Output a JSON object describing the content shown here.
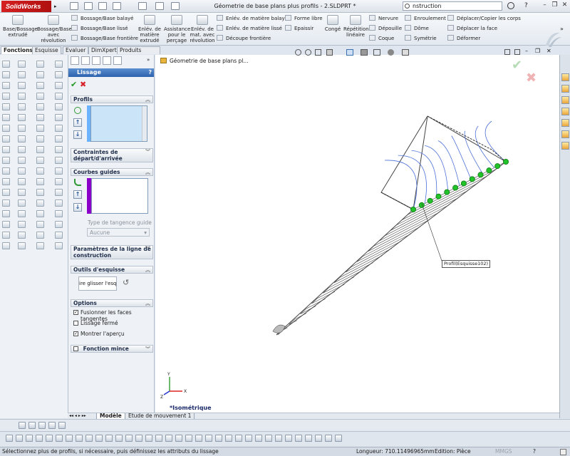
{
  "window": {
    "doc_title": "Géometrie de base plans plus profils - 2.SLDPRT *",
    "search_value": "nstruction",
    "min": "–",
    "restore": "❐",
    "close": "✕"
  },
  "ribbon": {
    "extrude": "Base/Bossage extrudé",
    "revolve": "Bossage/Base avec révolution",
    "sweep": "Bossage/Base balayé",
    "loft": "Bossage/Base lissé",
    "boundary": "Bossage/Base frontière",
    "cut_extrude": "Enlév. de matière extrudé",
    "hole": "Assistance pour le perçage",
    "cut_revolve": "Enlév. de mat. avec révolution",
    "cut_sweep": "Enlév. de matière balayé",
    "cut_loft": "Enlév. de matière lissé",
    "cut_boundary": "Découpe frontière",
    "freeform": "Forme libre",
    "thicken": "Epaissir",
    "fillet": "Congé",
    "pattern": "Répétition linéaire",
    "rib": "Nervure",
    "draft": "Dépouille",
    "shell": "Coque",
    "wrap": "Enroulement",
    "dome": "Dôme",
    "mirror": "Symétrie",
    "move_copy": "Déplacer/Copier les corps",
    "move_face": "Déplacer la face",
    "deform": "Déformer"
  },
  "tabs": [
    "Fonctions",
    "Esquisse",
    "Evaluer",
    "DimXpert",
    "Produits Office"
  ],
  "pm": {
    "title": "Lissage",
    "help": "?",
    "ok": "✔",
    "cancel": "✖",
    "profils_label": "Profils",
    "contraintes_label": "Contraintes de départ/d'arrivée",
    "courbes_label": "Courbes guides",
    "tangence_label": "Type de tangence guide",
    "tangence_value": "Aucune",
    "params_label": "Paramètres de la ligne de construction",
    "outils_label": "Outils d'esquisse",
    "drag_sketch": "ire glisser l'esquis",
    "options_label": "Options",
    "opt_merge": "Fusionner les faces tangentes",
    "opt_closed": "Lissage fermé",
    "opt_preview": "Montrer l'aperçu",
    "thin_label": "Fonction mince",
    "chev_up": "≫",
    "chev_down": "≫"
  },
  "graphics": {
    "tree_label": "Géometrie de base plans pl...",
    "callout": "Profil(Esquisse102)",
    "view_label": "*Isométrique",
    "axis_x": "X",
    "axis_y": "Y",
    "axis_z": "Z"
  },
  "bottom_tabs": {
    "model": "Modèle",
    "motion": "Etude de mouvement 1"
  },
  "status": {
    "hint": "Sélectionnez plus de profils, si nécessaire, puis définissez les attributs du lissage",
    "length": "Longueur: 710.11496965mm",
    "edition": "Edition: Pièce",
    "units": "MMGS",
    "help": "?"
  },
  "colors": {
    "accent": "#2d62ad",
    "selection_green": "#22c22a",
    "guide_purple": "#8a00c8",
    "cancel_red": "#d8222a"
  }
}
